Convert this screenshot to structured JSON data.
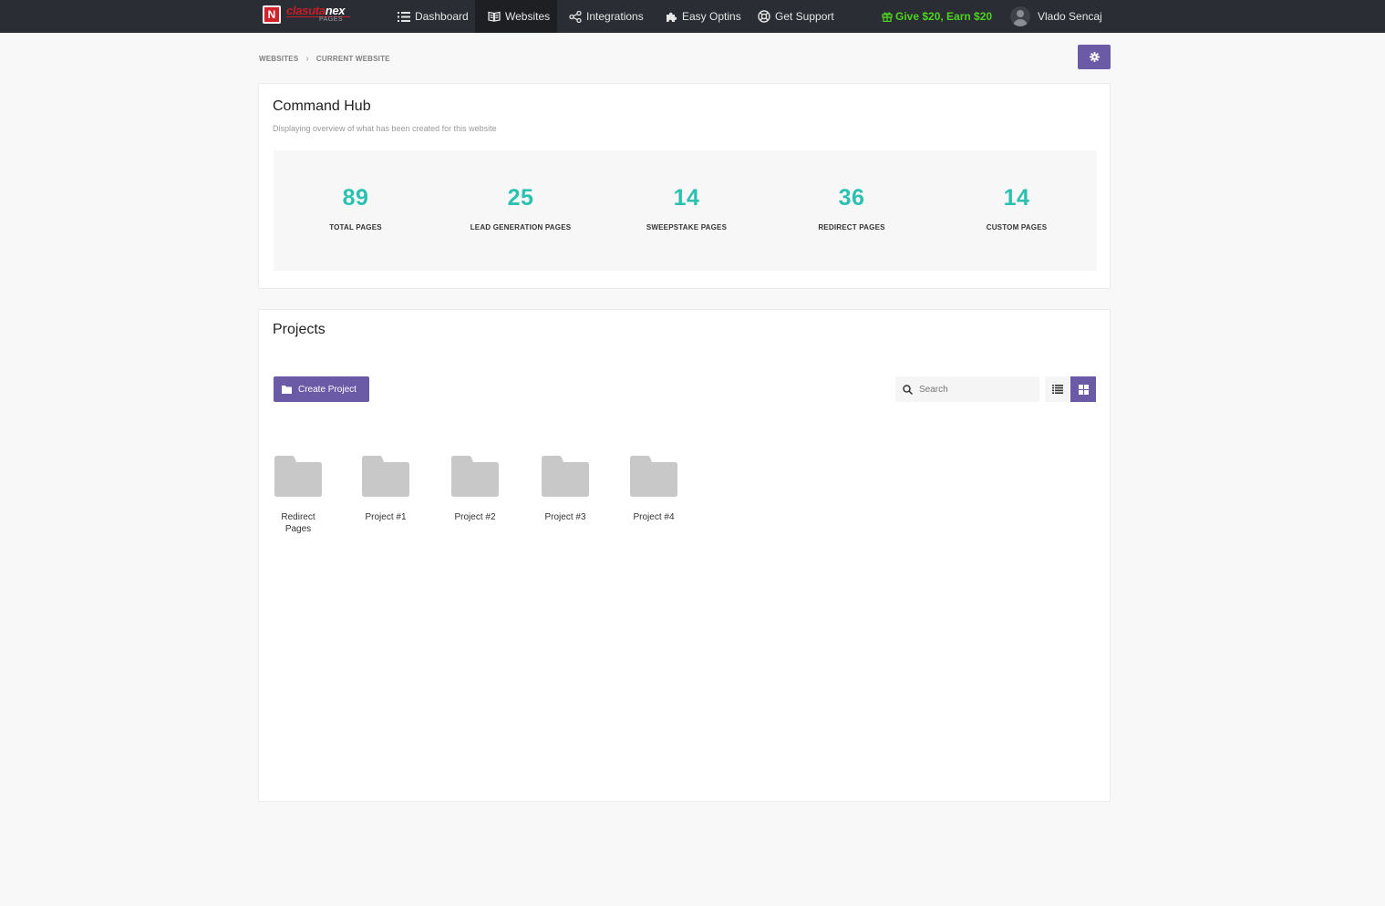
{
  "brand": {
    "logo_text_a": "clasuta",
    "logo_text_b": "nex",
    "logo_sub": "PAGES"
  },
  "nav": {
    "items": [
      {
        "label": "Dashboard",
        "icon": "list-icon"
      },
      {
        "label": "Websites",
        "icon": "book-icon",
        "active": true
      },
      {
        "label": "Integrations",
        "icon": "share-icon"
      },
      {
        "label": "Easy Optins",
        "icon": "puzzle-icon"
      },
      {
        "label": "Get Support",
        "icon": "lifebuoy-icon"
      }
    ],
    "promo": "Give $20, Earn $20",
    "user_name": "Vlado Sencaj"
  },
  "breadcrumb": [
    "WEBSITES",
    "CURRENT WEBSITE"
  ],
  "command_hub": {
    "title": "Command Hub",
    "subtitle": "Displaying overview of what has been created for this website",
    "stats": [
      {
        "value": "89",
        "label": "TOTAL PAGES"
      },
      {
        "value": "25",
        "label": "LEAD GENERATION PAGES"
      },
      {
        "value": "14",
        "label": "SWEEPSTAKE PAGES"
      },
      {
        "value": "36",
        "label": "REDIRECT PAGES"
      },
      {
        "value": "14",
        "label": "CUSTOM PAGES"
      }
    ]
  },
  "projects": {
    "title": "Projects",
    "create_label": "Create Project",
    "search_placeholder": "Search",
    "folders": [
      {
        "line1": "Redirect",
        "line2": "Pages"
      },
      {
        "line1": "Project  #1",
        "line2": ""
      },
      {
        "line1": "Project  #2",
        "line2": ""
      },
      {
        "line1": "Project  #3",
        "line2": ""
      },
      {
        "line1": "Project  #4",
        "line2": ""
      }
    ]
  },
  "colors": {
    "accent": "#6b5aa6",
    "stat": "#2bc1b0",
    "navbar": "#2a2d33",
    "promo": "#4ed321"
  }
}
